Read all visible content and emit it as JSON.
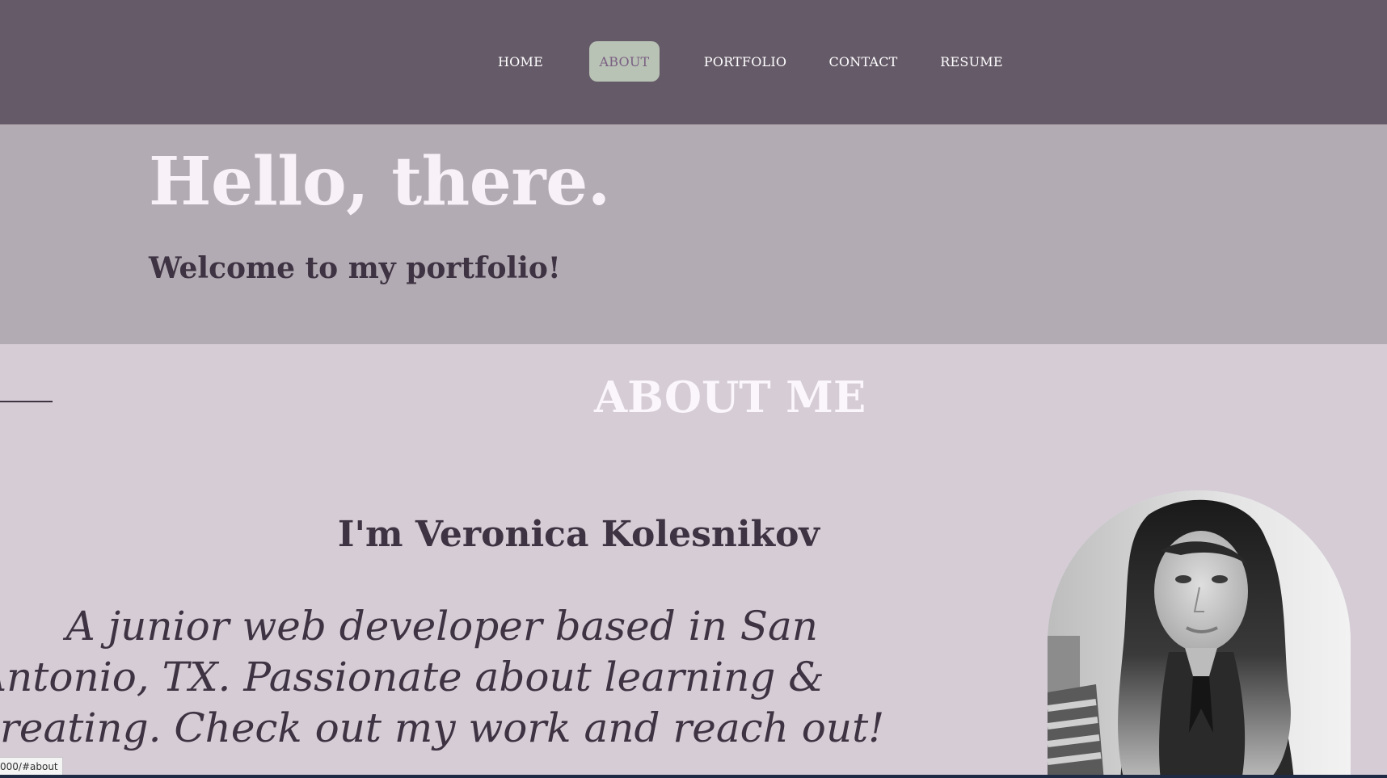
{
  "nav": {
    "items": [
      {
        "label": "HOME",
        "active": false
      },
      {
        "label": "ABOUT",
        "active": true
      },
      {
        "label": "PORTFOLIO",
        "active": false
      },
      {
        "label": "CONTACT",
        "active": false
      },
      {
        "label": "RESUME",
        "active": false
      }
    ]
  },
  "hero": {
    "title": "Hello, there.",
    "subtitle": "Welcome to my portfolio!"
  },
  "about": {
    "heading": "ABOUT ME",
    "name": "I'm Veronica Kolesnikov",
    "bio_lines": [
      "A junior web developer based in San",
      "Antonio, TX. Passionate about learning &",
      "creating. Check out my work and reach out!"
    ],
    "portrait_icon": "portrait-photo"
  },
  "status": {
    "url": "000/#about"
  },
  "colors": {
    "nav_bg": "#655a68",
    "nav_active_bg": "#b8c2b5",
    "nav_active_text": "#7a5f82",
    "hero_bg": "#b2abb3",
    "about_bg": "#d5ccd5",
    "heading_light": "#f8f1f8",
    "text_dark": "#3e3342"
  }
}
